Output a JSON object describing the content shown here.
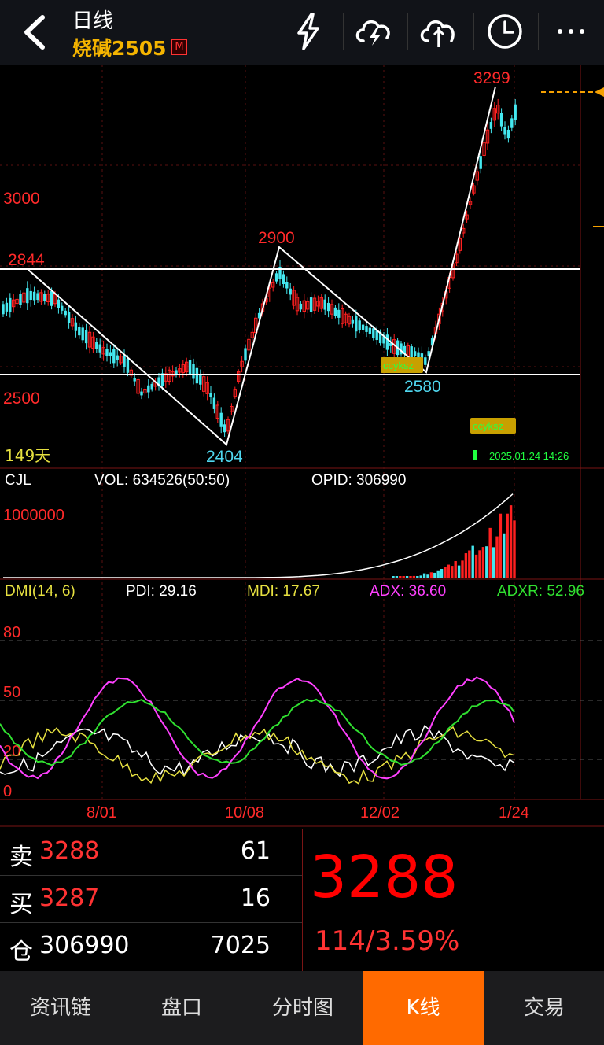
{
  "header": {
    "period": "日线",
    "symbol": "烧碱2505",
    "badge": "M",
    "icons": [
      "back-icon",
      "lightning-icon",
      "cloud-lightning-icon",
      "cloud-split-icon",
      "clock-icon",
      "more-icon"
    ]
  },
  "kchart": {
    "price_labels": {
      "p3000": "3000",
      "p2500": "2500"
    },
    "annotations": {
      "high_2844": "2844",
      "low_2404": "2404",
      "high_2900": "2900",
      "low_2580": "2580",
      "high_3299": "3299"
    },
    "days_label": "149天",
    "watermark": "ccyksz",
    "timestamp": "2025.01.24 14:26",
    "colors": {
      "up": "#ff2020",
      "down": "#44e8f0",
      "trendline": "#ffffff",
      "price_label": "#ff2a2a",
      "low_label": "#50d8f0"
    }
  },
  "volume": {
    "label": "CJL",
    "vol_text": "VOL: 634526(50:50)",
    "opid_text": "OPID: 306990",
    "scale_label": "1000000"
  },
  "dmi": {
    "label": "DMI(14, 6)",
    "pdi": "PDI: 29.16",
    "mdi": "MDI: 17.67",
    "adx": "ADX: 36.60",
    "adxr": "ADXR: 52.96",
    "levels": {
      "l80": "80",
      "l50": "50",
      "l20": "20",
      "l0": "0"
    },
    "colors": {
      "pdi": "#ffffff",
      "mdi": "#e6e040",
      "adx": "#ff40ff",
      "adxr": "#30e030"
    }
  },
  "dates": [
    "8/01",
    "10/08",
    "12/02",
    "1/24"
  ],
  "quotes": {
    "sell_label": "卖",
    "sell_price": "3288",
    "sell_vol": "61",
    "buy_label": "买",
    "buy_price": "3287",
    "buy_vol": "16",
    "oi_label": "仓",
    "oi_value": "306990",
    "oi_change": "7025",
    "last_price": "3288",
    "change": "114/3.59%"
  },
  "tabs": [
    "资讯链",
    "盘口",
    "分时图",
    "K线",
    "交易"
  ],
  "active_tab": "K线"
}
